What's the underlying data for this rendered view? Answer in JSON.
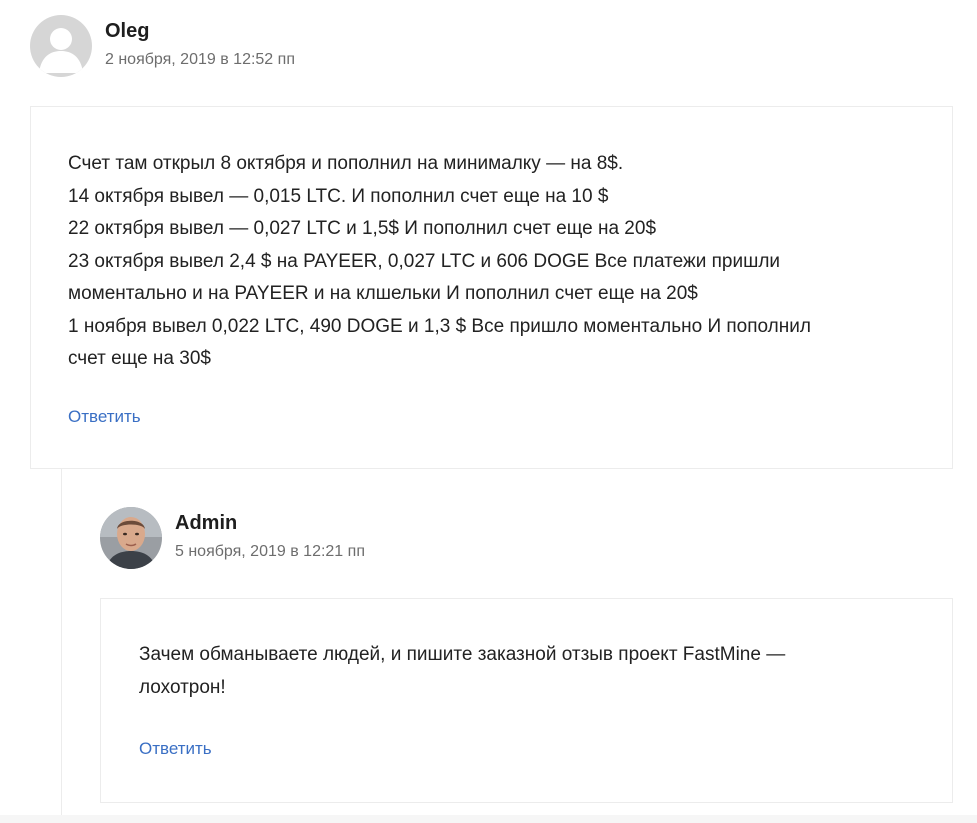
{
  "comments": [
    {
      "author": "Oleg",
      "date": "2 ноября, 2019 в 12:52 пп",
      "avatar_icon": "default-user-avatar-icon",
      "lines": [
        "Счет там открыл 8 октября и пополнил на минималку — на 8$.",
        "14 октября вывел — 0,015 LTC. И пополнил счет еще на 10 $",
        "22 октября вывел — 0,027 LTC и 1,5$ И пополнил счет еще на 20$",
        "23 октября вывел 2,4 $ на PAYEER, 0,027 LTC и 606 DOGE Все платежи пришли",
        "моментально и на PAYEER и на клшельки И пополнил счет еще на 20$",
        "1 ноября вывел 0,022 LTC, 490 DOGE и 1,3 $ Все пришло моментально И пополнил",
        "счет еще на 30$"
      ],
      "reply_label": "Ответить"
    },
    {
      "author": "Admin",
      "date": "5 ноября, 2019 в 12:21 пп",
      "avatar_icon": "admin-photo-avatar-icon",
      "lines": [
        "Зачем обманываете людей, и пишите заказной отзыв проект FastMine —",
        "лохотрон!"
      ],
      "reply_label": "Ответить"
    }
  ],
  "colors": {
    "link": "#3a6fc4",
    "border": "#ececec",
    "date": "#6d6d6d"
  }
}
